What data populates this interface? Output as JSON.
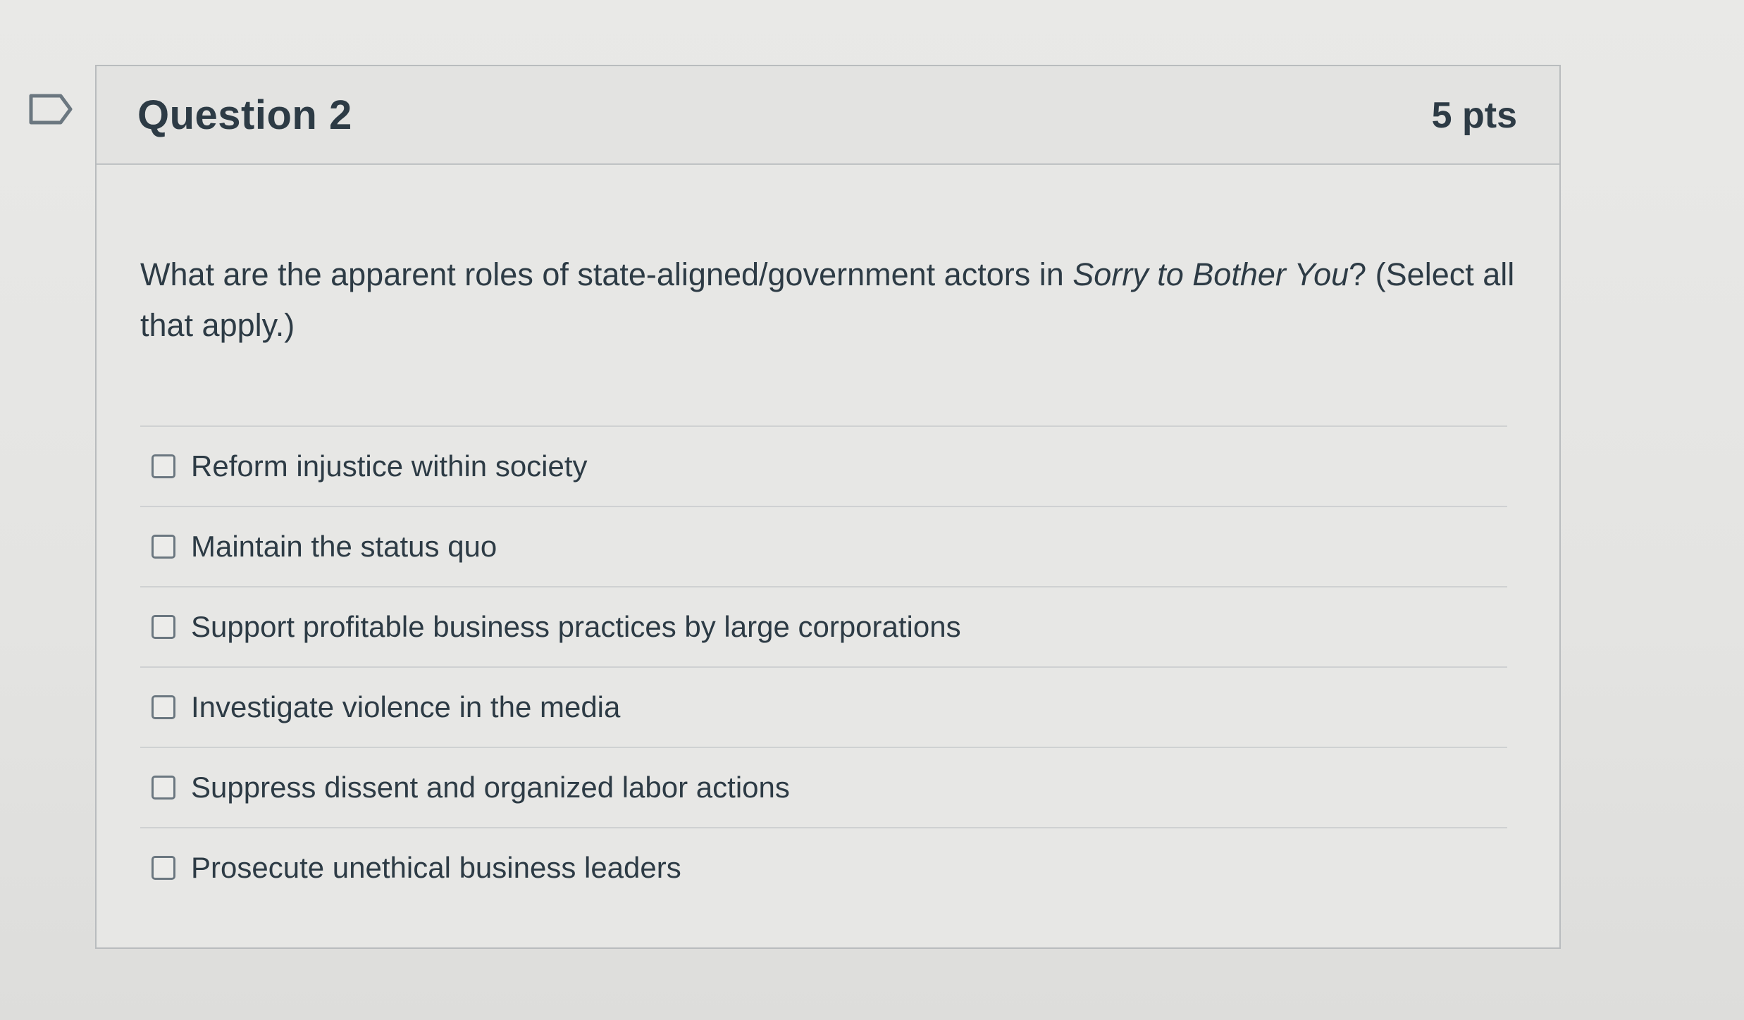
{
  "question": {
    "title": "Question 2",
    "points": "5 pts",
    "text_before": "What are the apparent roles of state-aligned/government actors in ",
    "text_italic": "Sorry to Bother You",
    "text_after": "? (Select all that apply.)",
    "answers": [
      {
        "label": "Reform injustice within society",
        "checked": false
      },
      {
        "label": "Maintain the status quo",
        "checked": false
      },
      {
        "label": "Support profitable business practices by large corporations",
        "checked": false
      },
      {
        "label": "Investigate violence in the media",
        "checked": false
      },
      {
        "label": "Suppress dissent and organized labor actions",
        "checked": false
      },
      {
        "label": "Prosecute unethical business leaders",
        "checked": false
      }
    ]
  },
  "icons": {
    "flag": "flag-question-icon",
    "checkbox": "checkbox-icon"
  },
  "colors": {
    "text": "#2d3b45",
    "border": "#b9bcbe",
    "background": "#e7e7e5"
  }
}
